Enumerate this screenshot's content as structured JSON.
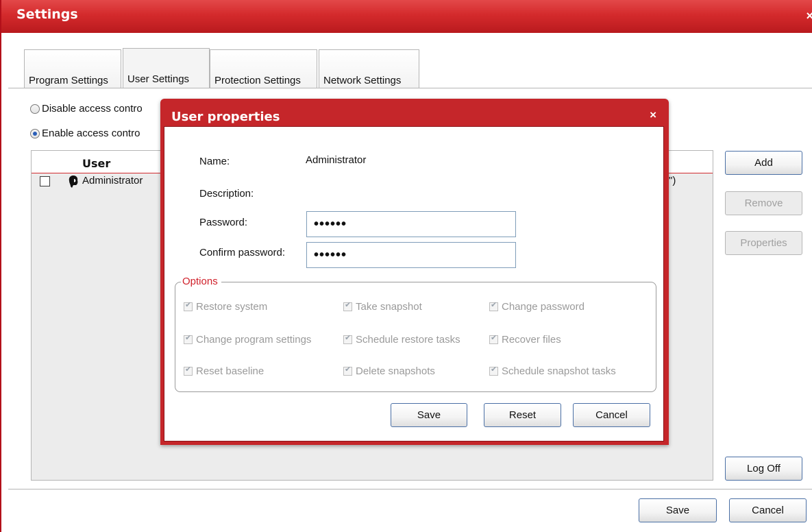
{
  "window": {
    "title": "Settings",
    "close_glyph": "×"
  },
  "tabs": [
    {
      "label": "Program Settings",
      "active": false
    },
    {
      "label": "User Settings",
      "active": true
    },
    {
      "label": "Protection Settings",
      "active": false
    },
    {
      "label": "Network Settings",
      "active": false
    }
  ],
  "access": {
    "disable_label": "Disable access contro",
    "enable_label": "Enable access contro",
    "selected": "enable"
  },
  "user_table": {
    "column_user": "User",
    "rows": [
      {
        "name": "Administrator",
        "checked": false,
        "trailing_text": "\")"
      }
    ]
  },
  "side_buttons": {
    "add": "Add",
    "remove": "Remove",
    "properties": "Properties",
    "log_off": "Log Off"
  },
  "footer_buttons": {
    "save": "Save",
    "cancel": "Cancel"
  },
  "dialog": {
    "title": "User properties",
    "close_glyph": "×",
    "name_label": "Name:",
    "name_value": "Administrator",
    "description_label": "Description:",
    "password_label": "Password:",
    "password_value": "••••••",
    "confirm_label": "Confirm password:",
    "confirm_value": "••••••",
    "options_legend": "Options",
    "options": [
      {
        "label": "Restore system",
        "checked": true,
        "enabled": false
      },
      {
        "label": "Take snapshot",
        "checked": true,
        "enabled": false
      },
      {
        "label": "Change password",
        "checked": true,
        "enabled": false
      },
      {
        "label": "Change program settings",
        "checked": true,
        "enabled": false
      },
      {
        "label": "Schedule restore tasks",
        "checked": true,
        "enabled": false
      },
      {
        "label": "Recover files",
        "checked": true,
        "enabled": false
      },
      {
        "label": "Reset baseline",
        "checked": true,
        "enabled": false
      },
      {
        "label": "Delete snapshots",
        "checked": true,
        "enabled": false
      },
      {
        "label": "Schedule snapshot tasks",
        "checked": true,
        "enabled": false
      }
    ],
    "buttons": {
      "save": "Save",
      "reset": "Reset",
      "cancel": "Cancel"
    }
  },
  "colors": {
    "titlebar": "#d42a2c",
    "accent_red": "#d0202a",
    "disabled_text": "#9a9a9a"
  }
}
